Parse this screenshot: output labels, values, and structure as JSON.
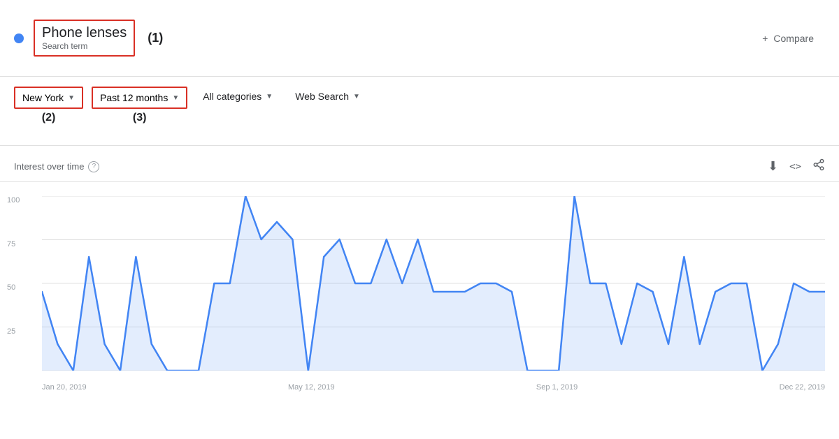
{
  "header": {
    "dot_color": "#4285f4",
    "search_term": "Phone lenses",
    "search_sub": "Search term",
    "annotation": "(1)",
    "compare_label": "Compare",
    "compare_plus": "+"
  },
  "filters": {
    "location": {
      "label": "New York",
      "annotation": "(2)"
    },
    "period": {
      "label": "Past 12 months",
      "annotation": "(3)"
    },
    "category": {
      "label": "All categories"
    },
    "search_type": {
      "label": "Web Search"
    }
  },
  "chart": {
    "title": "Interest over time",
    "help_icon": "?",
    "y_labels": [
      "100",
      "75",
      "50",
      "25",
      ""
    ],
    "x_labels": [
      "Jan 20, 2019",
      "May 12, 2019",
      "Sep 1, 2019",
      "Dec 22, 2019"
    ],
    "download_icon": "⬇",
    "embed_icon": "<>",
    "share_icon": "share"
  }
}
